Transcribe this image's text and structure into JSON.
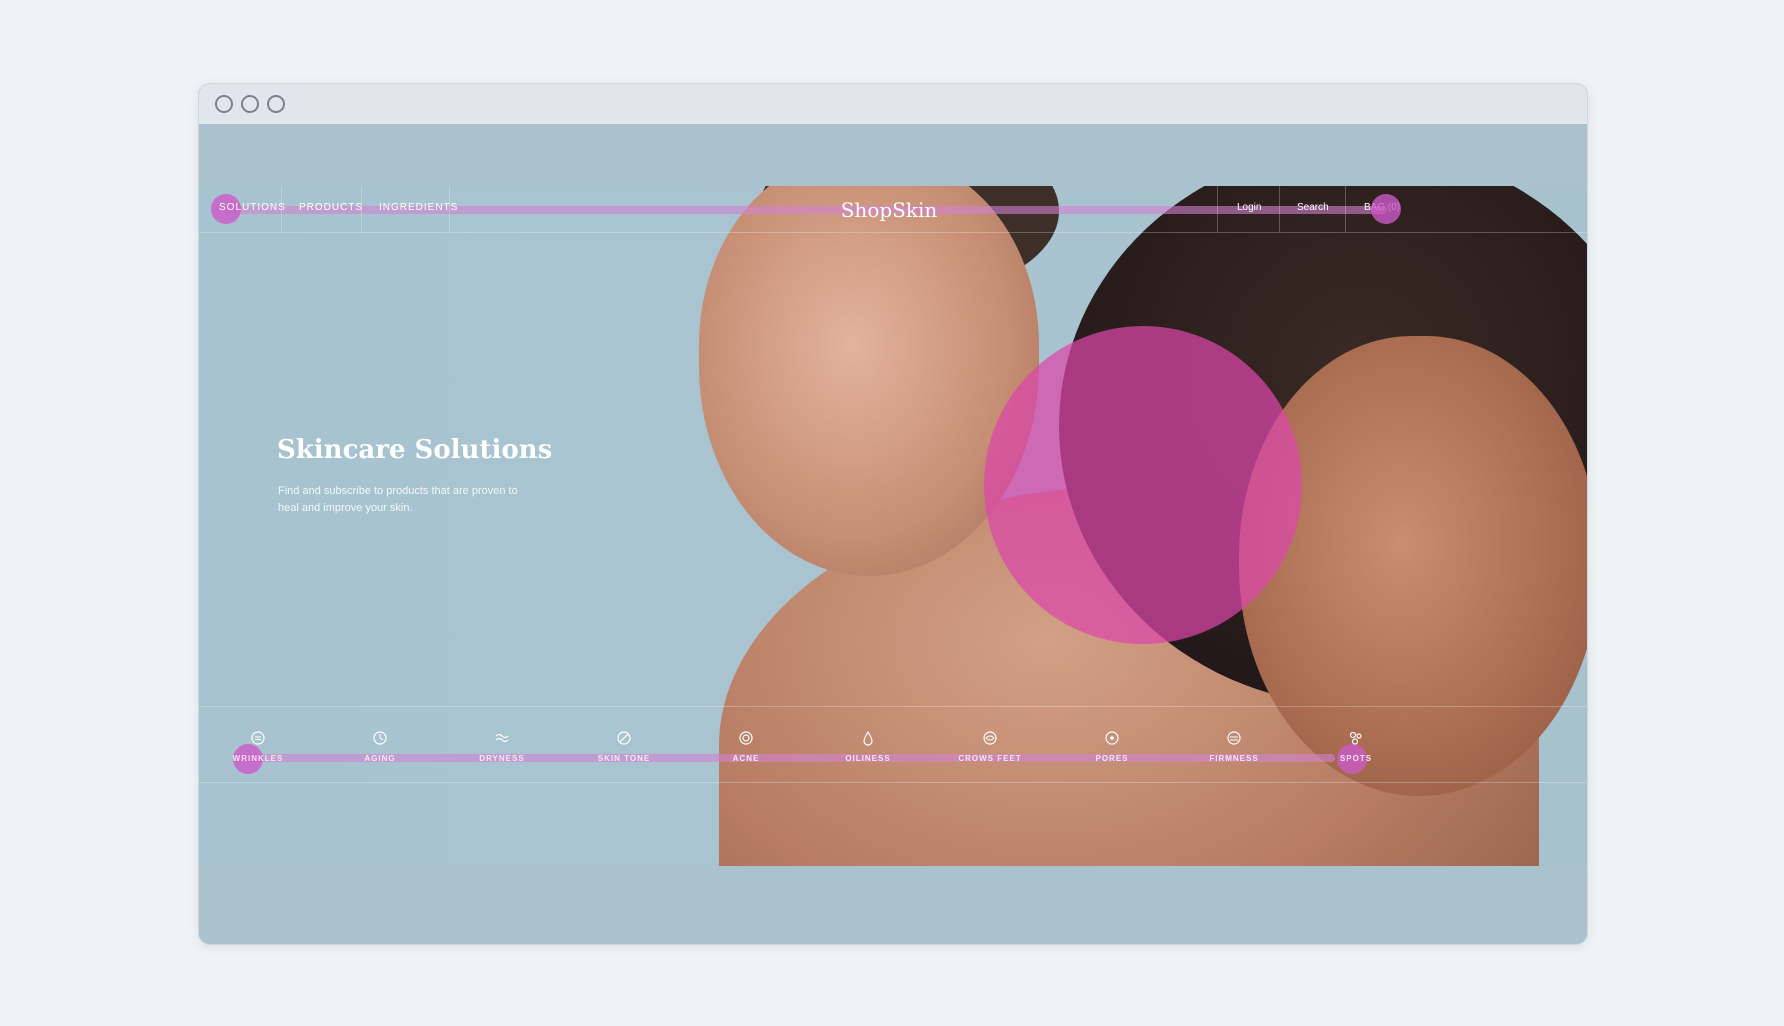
{
  "window": {
    "controls": [
      "close",
      "minimize",
      "maximize"
    ]
  },
  "nav": {
    "left": [
      "SOLUTIONS",
      "PRODUCTS",
      "INGREDIENTS"
    ],
    "brand": "ShopSkin",
    "right": [
      "Login",
      "Search",
      "BAG (0)"
    ]
  },
  "hero": {
    "title": "Skincare Solutions",
    "subtitle": "Find and subscribe to products that are proven to heal and improve your skin."
  },
  "concerns": [
    {
      "label": "WRINKLES",
      "icon": "face-wrinkle-icon"
    },
    {
      "label": "AGING",
      "icon": "clock-icon"
    },
    {
      "label": "DRYNESS",
      "icon": "wave-icon"
    },
    {
      "label": "SKIN TONE",
      "icon": "tone-icon"
    },
    {
      "label": "ACNE",
      "icon": "target-icon"
    },
    {
      "label": "OILINESS",
      "icon": "drop-icon"
    },
    {
      "label": "CROWS FEET",
      "icon": "eye-icon"
    },
    {
      "label": "PORES",
      "icon": "dot-circle-icon"
    },
    {
      "label": "FIRMNESS",
      "icon": "lines-icon"
    },
    {
      "label": "SPOTS",
      "icon": "spots-icon"
    }
  ],
  "colors": {
    "accent": "#dd46aa",
    "hero_bg": "#a9c4d0"
  }
}
